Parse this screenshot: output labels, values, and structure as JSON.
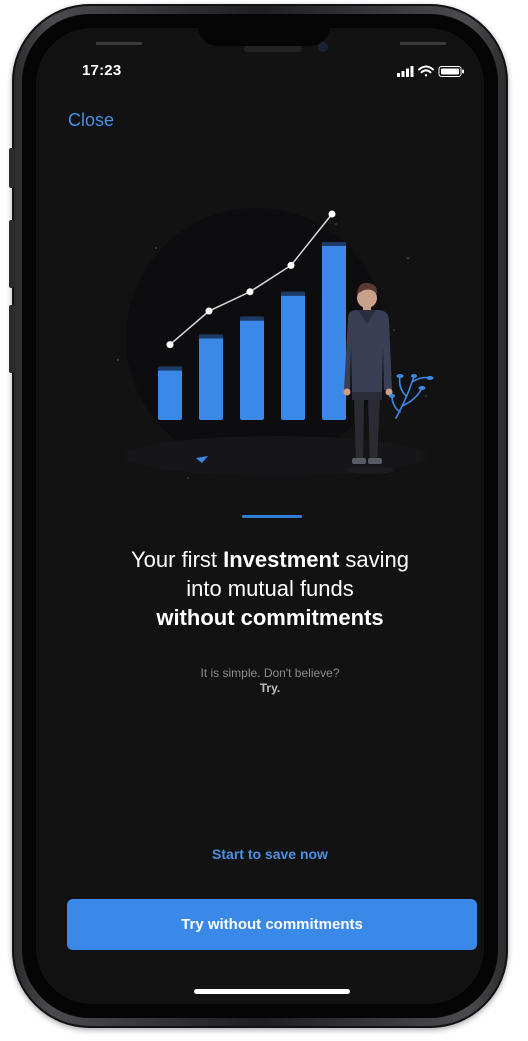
{
  "status_bar": {
    "time": "17:23",
    "icons": [
      "cellular-signal-icon",
      "wifi-icon",
      "battery-icon"
    ]
  },
  "header": {
    "close_label": "Close"
  },
  "illustration": {
    "icon": "investment-growth-chart-illustration",
    "bar_levels": [
      0.3,
      0.48,
      0.58,
      0.72,
      1.0
    ],
    "colors": {
      "bar": "#3a88e8",
      "bar_top": "#1c3b66",
      "trend_line": "#ffffff",
      "backdrop": "#0d0d0f"
    }
  },
  "content": {
    "headline": {
      "prefix": "Your first ",
      "bold_word": "Investment",
      "suffix": " saving",
      "line2": "into mutual funds",
      "line3": "without commitments"
    },
    "subtext": {
      "line1": "It is simple. Don't believe?",
      "line2": "Try."
    }
  },
  "actions": {
    "secondary_label": "Start to save now",
    "primary_label": "Try without commitments"
  },
  "theme": {
    "background": "#121212",
    "accent": "#3a88e8",
    "link": "#4a90e2",
    "text": "#ffffff",
    "muted_text": "#8b8b8e"
  }
}
